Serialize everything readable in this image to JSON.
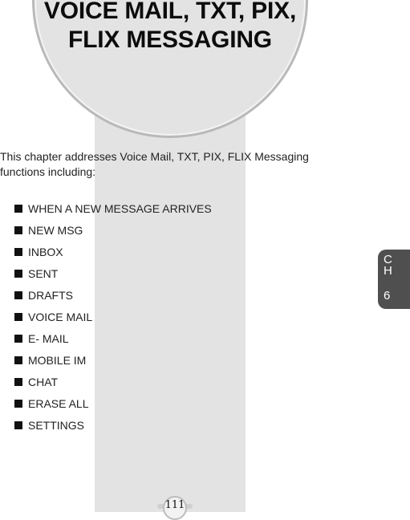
{
  "header": {
    "title_line1": "VOICE MAIL, TXT, PIX,",
    "title_line2": "FLIX MESSAGING"
  },
  "intro": {
    "text": "This chapter addresses Voice Mail, TXT, PIX, FLIX Messaging functions including:"
  },
  "topics": [
    {
      "label": "WHEN A NEW MESSAGE ARRIVES"
    },
    {
      "label": "NEW MSG"
    },
    {
      "label": "INBOX"
    },
    {
      "label": "SENT"
    },
    {
      "label": "DRAFTS"
    },
    {
      "label": "VOICE MAIL"
    },
    {
      "label": "E- MAIL"
    },
    {
      "label": "MOBILE IM"
    },
    {
      "label": "CHAT"
    },
    {
      "label": "ERASE ALL"
    },
    {
      "label": "SETTINGS"
    }
  ],
  "chapter_tab": {
    "letter1": "C",
    "letter2": "H",
    "number": "6"
  },
  "page_number": "111",
  "colors": {
    "band": "#e3e3e3",
    "tab": "#4f4f4f",
    "bullet": "#111111"
  }
}
